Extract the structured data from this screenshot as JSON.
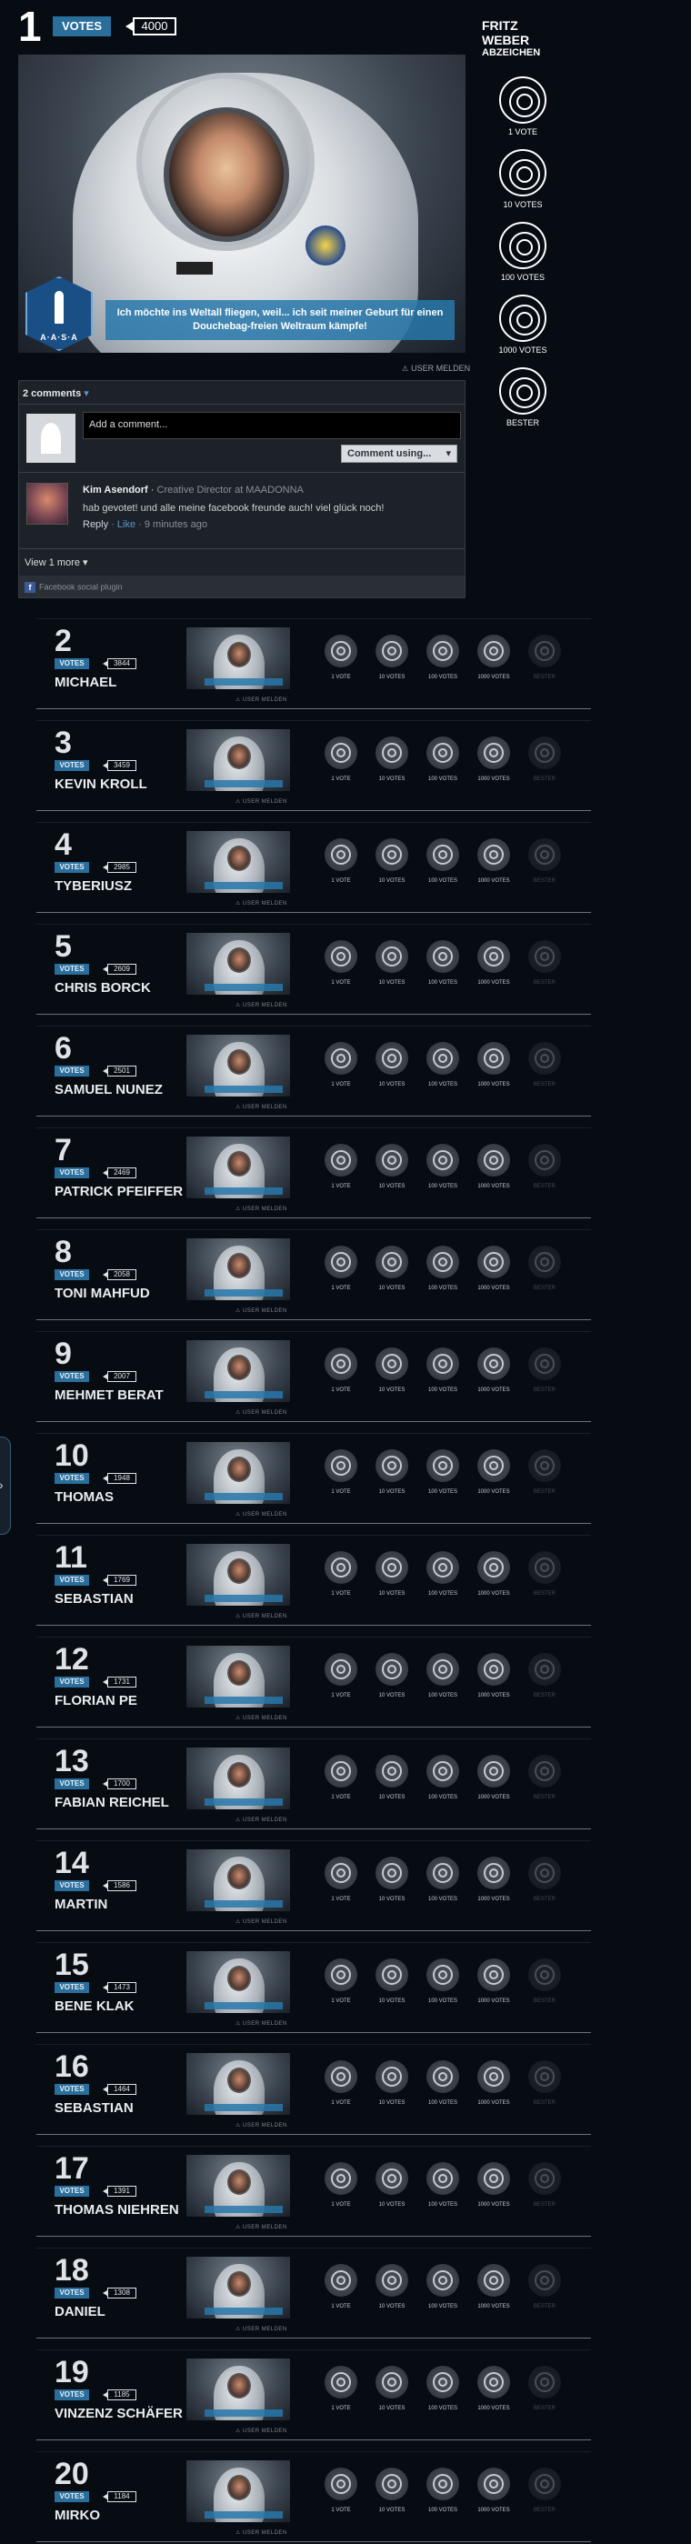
{
  "winner": {
    "rank": "1",
    "votes_label": "VOTES",
    "count": "4000",
    "banner": "Ich möchte ins Weltall fliegen, weil... ich seit meiner Geburt für einen Douchebag-freien Weltraum kämpfe!",
    "badge_text": "A·A·S·A",
    "user_melden": "USER MELDEN"
  },
  "badges": {
    "title_line1": "FRITZ",
    "title_line2": "WEBER",
    "title_line3": "ABZEICHEN",
    "items": [
      {
        "label": "1 VOTE",
        "icon": "one-vote-badge-icon"
      },
      {
        "label": "10 VOTES",
        "icon": "ten-votes-badge-icon"
      },
      {
        "label": "100 VOTES",
        "icon": "hundred-votes-badge-icon"
      },
      {
        "label": "1000 VOTES",
        "icon": "thousand-votes-badge-icon"
      },
      {
        "label": "BESTER",
        "icon": "best-badge-icon"
      }
    ]
  },
  "comments": {
    "header": "2 comments",
    "input_placeholder": "Add a comment...",
    "post_button": "Comment using...",
    "comment": {
      "author": "Kim Asendorf",
      "role": "Creative Director at MAADONNA",
      "text": "hab gevotet! und alle meine facebook freunde auch! viel glück noch!",
      "reply": "Reply",
      "like": "Like",
      "time": "9 minutes ago"
    },
    "view_more": "View 1 more",
    "plugin": "Facebook social plugin"
  },
  "entry_badge_labels": [
    "1 VOTE",
    "10 VOTES",
    "100 VOTES",
    "1000 VOTES",
    "BESTER"
  ],
  "entry_votes_label": "VOTES",
  "entry_user_melden": "USER MELDEN",
  "entries": [
    {
      "rank": "2",
      "count": "3844",
      "name": "MICHAEL"
    },
    {
      "rank": "3",
      "count": "3459",
      "name": "KEVIN KROLL"
    },
    {
      "rank": "4",
      "count": "2985",
      "name": "TYBERIUSZ"
    },
    {
      "rank": "5",
      "count": "2609",
      "name": "CHRIS BORCK"
    },
    {
      "rank": "6",
      "count": "2501",
      "name": "SAMUEL NUNEZ"
    },
    {
      "rank": "7",
      "count": "2469",
      "name": "PATRICK PFEIFFER"
    },
    {
      "rank": "8",
      "count": "2058",
      "name": "TONI MAHFUD"
    },
    {
      "rank": "9",
      "count": "2007",
      "name": "MEHMET BERAT"
    },
    {
      "rank": "10",
      "count": "1948",
      "name": "THOMAS"
    },
    {
      "rank": "11",
      "count": "1769",
      "name": "SEBASTIAN"
    },
    {
      "rank": "12",
      "count": "1731",
      "name": "FLORIAN PE"
    },
    {
      "rank": "13",
      "count": "1700",
      "name": "FABIAN REICHEL"
    },
    {
      "rank": "14",
      "count": "1586",
      "name": "MARTIN"
    },
    {
      "rank": "15",
      "count": "1473",
      "name": "BENE KLAK"
    },
    {
      "rank": "16",
      "count": "1464",
      "name": "SEBASTIAN"
    },
    {
      "rank": "17",
      "count": "1391",
      "name": "THOMAS NIEHREN"
    },
    {
      "rank": "18",
      "count": "1308",
      "name": "DANIEL"
    },
    {
      "rank": "19",
      "count": "1185",
      "name": "VINZENZ SCHÄFER"
    },
    {
      "rank": "20",
      "count": "1184",
      "name": "MIRKO"
    }
  ]
}
